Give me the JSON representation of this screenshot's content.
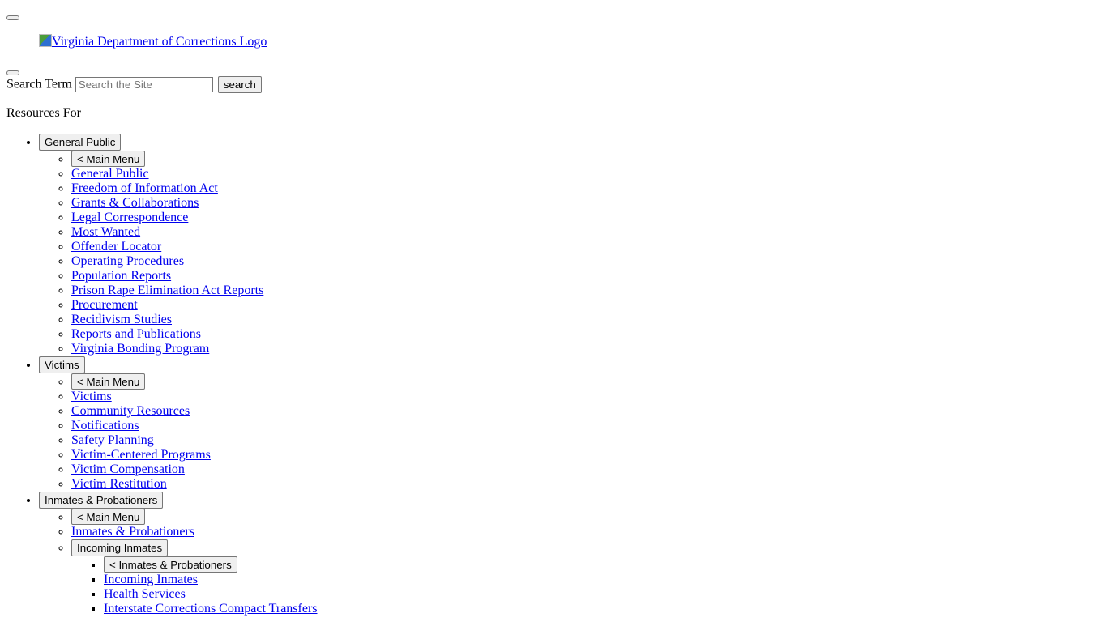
{
  "header": {
    "logo_alt": "Virginia Department of Corrections Logo"
  },
  "search": {
    "label": "Search Term",
    "placeholder": "Search the Site",
    "button_label": "search"
  },
  "resources": {
    "heading": "Resources For",
    "sections": [
      {
        "button_label": "General Public",
        "back_label": "< Main Menu",
        "links": [
          "General Public",
          "Freedom of Information Act",
          "Grants & Collaborations",
          "Legal Correspondence",
          "Most Wanted",
          "Offender Locator",
          "Operating Procedures",
          "Population Reports",
          "Prison Rape Elimination Act Reports",
          "Procurement",
          "Recidivism Studies",
          "Reports and Publications",
          "Virginia Bonding Program"
        ]
      },
      {
        "button_label": "Victims",
        "back_label": "< Main Menu",
        "links": [
          "Victims",
          "Community Resources",
          "Notifications",
          "Safety Planning",
          "Victim-Centered Programs",
          "Victim Compensation",
          "Victim Restitution"
        ]
      },
      {
        "button_label": "Inmates & Probationers",
        "back_label": "< Main Menu",
        "links": [
          "Inmates & Probationers"
        ],
        "submenu": {
          "button_label": "Incoming Inmates",
          "back_label": "< Inmates & Probationers",
          "links": [
            "Incoming Inmates",
            "Health Services",
            "Interstate Corrections Compact Transfers"
          ]
        }
      }
    ]
  }
}
